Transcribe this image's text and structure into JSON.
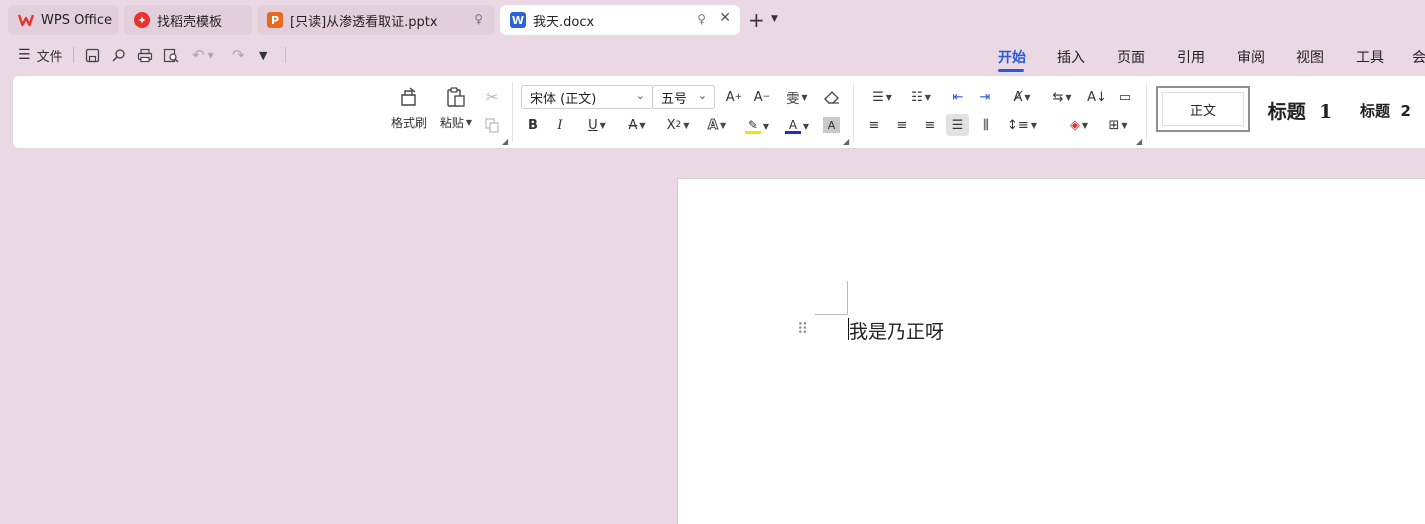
{
  "tabs": [
    {
      "label": "WPS Office",
      "icon": "wps-logo-icon"
    },
    {
      "label": "找稻壳模板",
      "icon": "docer-logo-icon"
    },
    {
      "label": "[只读]从渗透看取证.pptx",
      "icon": "presentation-file-icon"
    },
    {
      "label": "我天.docx",
      "icon": "writer-file-icon",
      "active": true
    }
  ],
  "quick_access": {
    "file_label": "文件"
  },
  "menu_tabs": [
    "开始",
    "插入",
    "页面",
    "引用",
    "审阅",
    "视图",
    "工具",
    "会"
  ],
  "ribbon": {
    "format_painter": "格式刷",
    "paste": "粘贴",
    "font_name": "宋体 (正文)",
    "font_size": "五号",
    "styles": {
      "normal": "正文",
      "heading1": "标题  1",
      "heading2": "标题  2"
    }
  },
  "document": {
    "text": "我是乃正呀"
  },
  "colors": {
    "accent": "#2a5bd7",
    "highlight": "#f5e400",
    "font_color": "#1a2fcc",
    "wps_red": "#e8322c",
    "ppt_orange": "#e66a1f",
    "word_blue": "#2b63d9"
  }
}
